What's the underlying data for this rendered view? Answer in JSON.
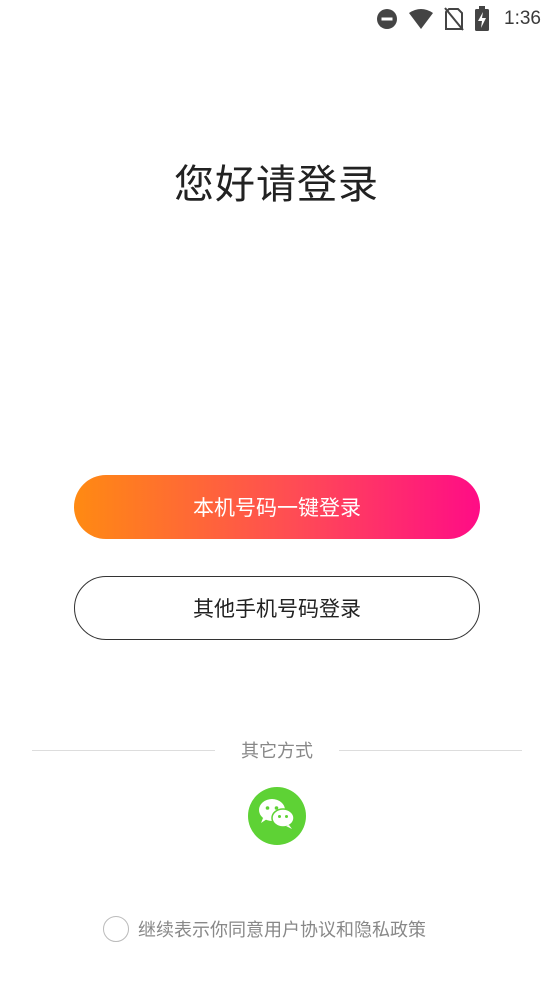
{
  "status_bar": {
    "time": "1:36",
    "icons": [
      "do-not-disturb-icon",
      "wifi-icon",
      "no-sim-icon",
      "battery-charging-icon"
    ]
  },
  "title": "您好请登录",
  "buttons": {
    "one_click_login": "本机号码一键登录",
    "other_phone_login": "其他手机号码登录"
  },
  "other_methods": {
    "label": "其它方式",
    "wechat_icon": "wechat-icon"
  },
  "agreement": {
    "text": "继续表示你同意用户协议和隐私政策",
    "checked": false
  },
  "colors": {
    "gradient_start": "#ff8a12",
    "gradient_end": "#ff0c86",
    "wechat_green": "#5ed235"
  }
}
